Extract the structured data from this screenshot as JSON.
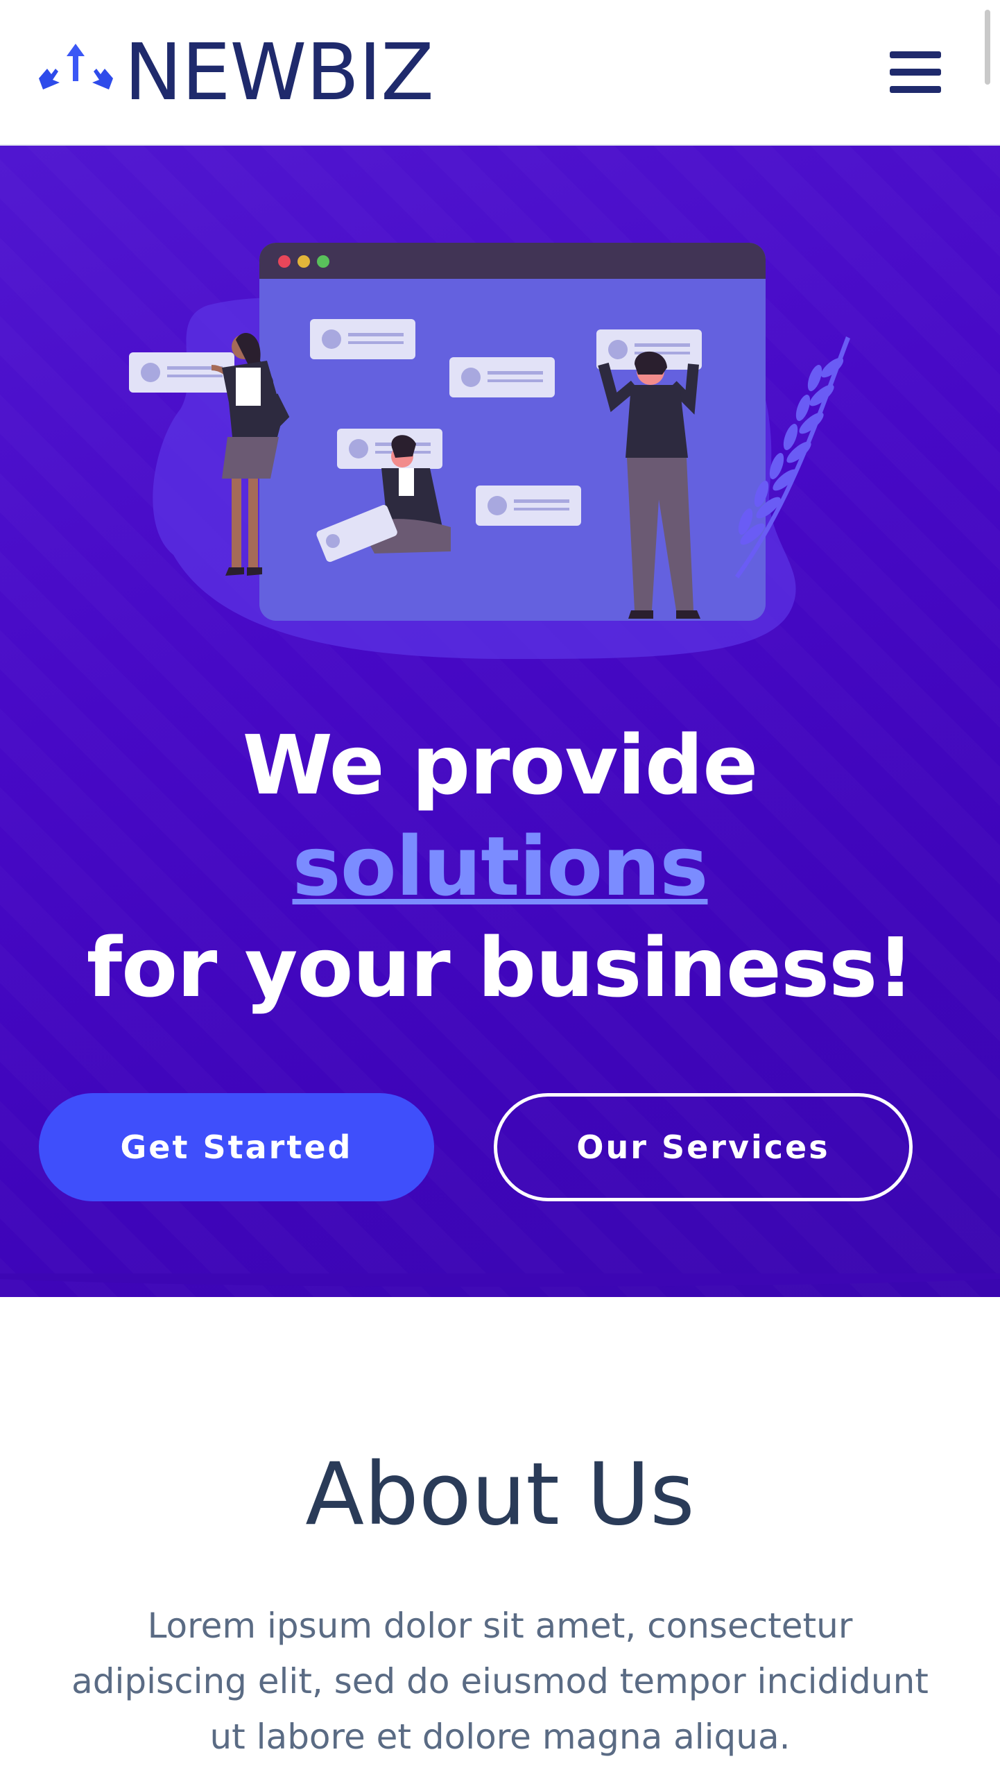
{
  "header": {
    "logo_text": "NEWBIZ",
    "menu_icon": "hamburger-menu-icon",
    "logo_icon": "arrows-split-icon"
  },
  "hero": {
    "title_line1": "We provide",
    "title_accent": "solutions",
    "title_line3": "for your business!",
    "primary_button": "Get Started",
    "secondary_button": "Our Services",
    "illustration": "team-working-on-browser-illustration"
  },
  "about": {
    "title": "About Us",
    "text": "Lorem ipsum dolor sit amet, consectetur adipiscing elit, sed do eiusmod tempor incididunt ut labore et dolore magna aliqua."
  },
  "colors": {
    "brand_navy": "#1f2a6c",
    "hero_purple": "#4709c6",
    "accent_blue": "#3f4ffb",
    "accent_light": "#7b8cff"
  }
}
